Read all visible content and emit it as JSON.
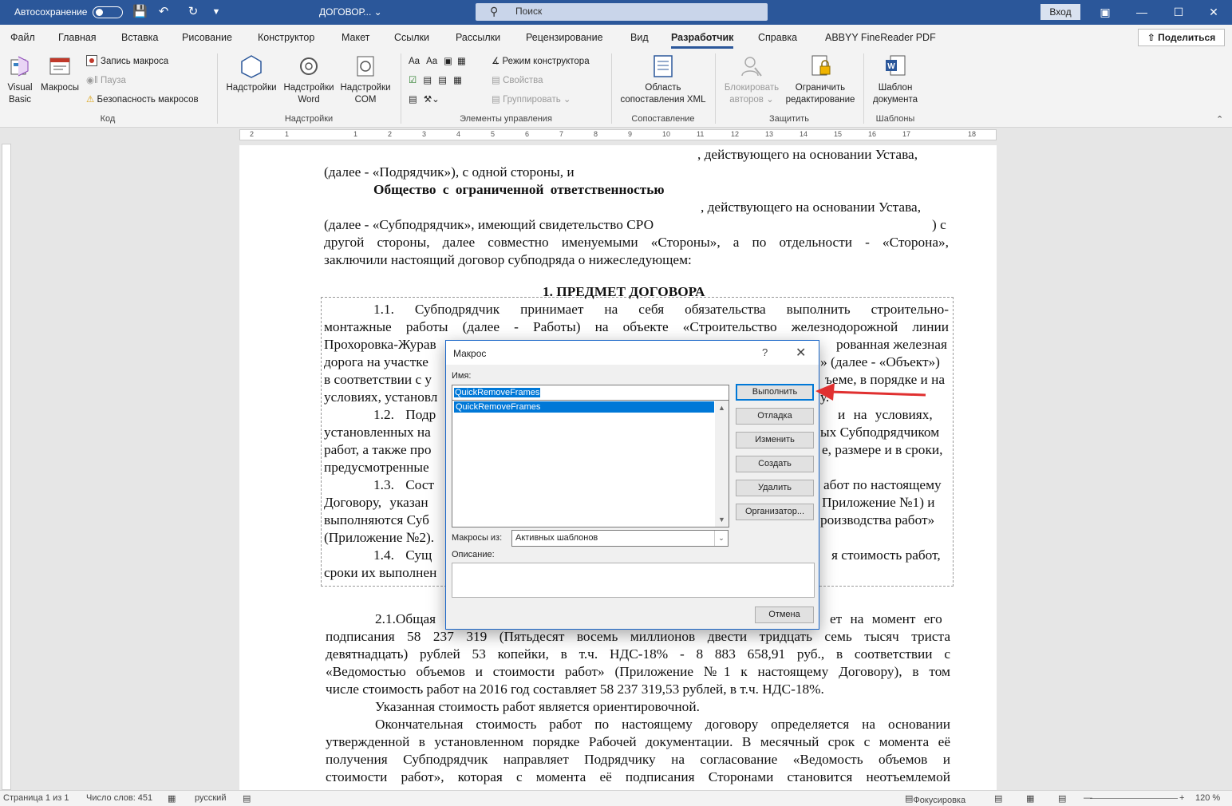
{
  "titlebar": {
    "autosave_label": "Автосохранение",
    "doc_title": "ДОГОВОР...",
    "search_placeholder": "Поиск",
    "login_label": "Вход",
    "icons": [
      "save-icon",
      "undo-icon",
      "redo-icon",
      "customize-icon"
    ]
  },
  "tabs": [
    {
      "label": "Файл"
    },
    {
      "label": "Главная"
    },
    {
      "label": "Вставка"
    },
    {
      "label": "Рисование"
    },
    {
      "label": "Конструктор"
    },
    {
      "label": "Макет"
    },
    {
      "label": "Ссылки"
    },
    {
      "label": "Рассылки"
    },
    {
      "label": "Рецензирование"
    },
    {
      "label": "Вид"
    },
    {
      "label": "Разработчик"
    },
    {
      "label": "Справка"
    },
    {
      "label": "ABBYY FineReader PDF"
    }
  ],
  "share_label": "Поделиться",
  "ribbon": {
    "code": {
      "label": "Код",
      "visual_basic": "Visual Basic",
      "visual_basic_l1": "Visual",
      "visual_basic_l2": "Basic",
      "macros": "Макросы",
      "record_macro": "Запись макроса",
      "pause": "Пауза",
      "macro_security": "Безопасность макросов"
    },
    "addins": {
      "label": "Надстройки",
      "addins": "Надстройки",
      "word_addins_l1": "Надстройки",
      "word_addins_l2": "Word",
      "com_addins_l1": "Надстройки",
      "com_addins_l2": "COM"
    },
    "controls": {
      "label": "Элементы управления",
      "design_mode": "Режим конструктора",
      "properties": "Свойства",
      "group": "Группировать"
    },
    "mapping": {
      "label": "Сопоставление",
      "xml_l1": "Область",
      "xml_l2": "сопоставления XML"
    },
    "protect": {
      "label": "Защитить",
      "block_l1": "Блокировать",
      "block_l2": "авторов",
      "restrict_l1": "Ограничить",
      "restrict_l2": "редактирование"
    },
    "templates": {
      "label": "Шаблоны",
      "doc_template_l1": "Шаблон",
      "doc_template_l2": "документа"
    }
  },
  "ruler": [
    "2",
    "1",
    "1",
    "2",
    "3",
    "4",
    "5",
    "6",
    "7",
    "8",
    "9",
    "10",
    "11",
    "12",
    "13",
    "14",
    "15",
    "16",
    "17",
    "18"
  ],
  "document": {
    "lines": [
      ", действующего на основании Устава,",
      "(далее - «Подрядчик»), с одной стороны, и",
      "Общество с ограниченной ответственностью",
      ", действующего на основании Устава,",
      "(далее - «Субподрядчик», имеющий свидетельство СРО",
      ") с",
      "другой стороны, далее совместно именуемыми «Стороны», а по отдельности - «Сторона»,",
      "заключили настоящий договор субподряда о нижеследующем:",
      "1. ПРЕДМЕТ ДОГОВОРА",
      "1.1. Субподрядчик принимает на себя обязательства выполнить строительно-",
      "монтажные работы (далее - Работы) на объекте «Строительство железнодорожной линии",
      "Прохоровка-Журав",
      "рованная железная",
      "дорога на участке",
      "» (далее - «Объект»)",
      "в соответствии с у",
      "ъеме, в порядке и на",
      "условиях, установл",
      "у.",
      "1.2. Подр",
      "и на условиях,",
      "установленных на",
      "ых Субподрядчиком",
      "работ, а также про",
      "е, размере и в сроки,",
      "предусмотренные",
      "1.3. Сост",
      "абот по настоящему",
      "Договору, указан",
      "Приложение №1) и",
      "выполняются Суб",
      "роизводства работ»",
      "(Приложение №2).",
      "1.4. Сущ",
      "я стоимость работ,",
      "сроки их выполнен",
      "2.1.Общая",
      "ет на момент его",
      "подписания 58 237 319 (Пятьдесят восемь миллионов двести тридцать семь тысяч триста",
      "девятнадцать) рублей 53 копейки, в т.ч. НДС-18% - 8 883 658,91 руб., в соответствии с",
      "«Ведомостью объемов и стоимости работ» (Приложение №1 к настоящему Договору), в том",
      "числе стоимость работ на 2016 год составляет 58 237 319,53 рублей, в т.ч. НДС-18%.",
      "Указанная стоимость работ является ориентировочной.",
      "Окончательная стоимость работ по настоящему договору определяется на основании",
      "утвержденной в установленном порядке Рабочей документации. В месячный срок с момента её",
      "получения Субподрядчик направляет Подрядчику на согласование «Ведомость объемов и",
      "стоимости работ», которая с момента её подписания Сторонами становится неотъемлемой"
    ]
  },
  "dialog": {
    "title": "Макрос",
    "help": "?",
    "close": "✕",
    "name_label": "Имя:",
    "name_value": "QuickRemoveFrames",
    "list_items": [
      "QuickRemoveFrames"
    ],
    "run": "Выполнить",
    "step": "Отладка",
    "edit": "Изменить",
    "create": "Создать",
    "delete": "Удалить",
    "organizer": "Организатор...",
    "macros_from_label": "Макросы из:",
    "macros_from_value": "Активных шаблонов",
    "description_label": "Описание:",
    "cancel": "Отмена"
  },
  "statusbar": {
    "page": "Страница 1 из 1",
    "words": "Число слов: 451",
    "language": "русский",
    "focus": "Фокусировка",
    "zoom": "120 %"
  },
  "colors": {
    "titlebar": "#2b579a",
    "accent": "#0078d7",
    "arrow": "#e03030"
  }
}
